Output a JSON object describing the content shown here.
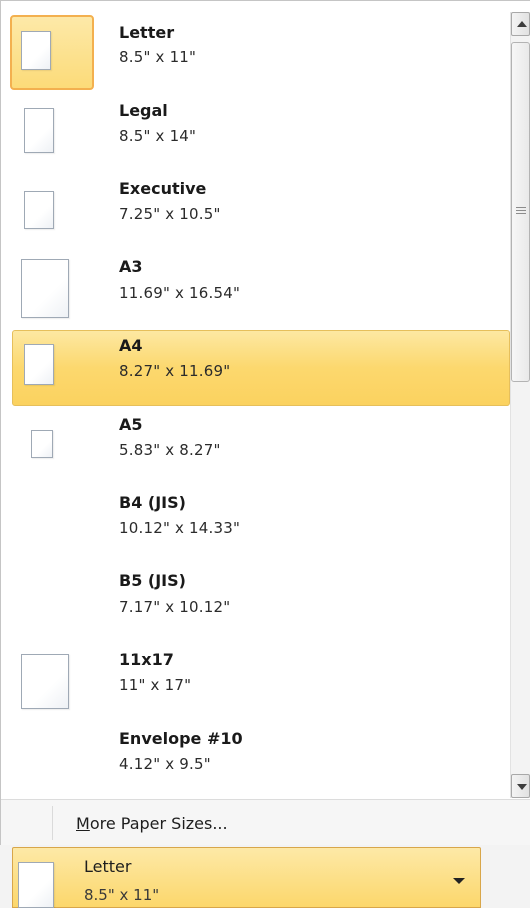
{
  "paper_sizes": [
    {
      "name": "Letter",
      "dims": "8.5\" x 11\""
    },
    {
      "name": "Legal",
      "dims": "8.5\" x 14\""
    },
    {
      "name": "Executive",
      "dims": "7.25\" x 10.5\""
    },
    {
      "name": "A3",
      "dims": "11.69\" x 16.54\""
    },
    {
      "name": "A4",
      "dims": "8.27\" x 11.69\""
    },
    {
      "name": "A5",
      "dims": "5.83\" x 8.27\""
    },
    {
      "name": "B4 (JIS)",
      "dims": "10.12\" x 14.33\""
    },
    {
      "name": "B5 (JIS)",
      "dims": "7.17\" x 10.12\""
    },
    {
      "name": "11x17",
      "dims": "11\" x 17\""
    },
    {
      "name": "Envelope #10",
      "dims": "4.12\" x 9.5\""
    }
  ],
  "selected_item": "Letter",
  "hovered_item": "A4",
  "more_link": {
    "mnemonic": "M",
    "rest": "ore Paper Sizes..."
  },
  "dropdown": {
    "name": "Letter",
    "dims": "8.5\" x 11\""
  },
  "colors": {
    "hover_bg": "#fcd86e",
    "selected_border": "#f3b04f",
    "thumb_border": "#9fa9b5"
  }
}
